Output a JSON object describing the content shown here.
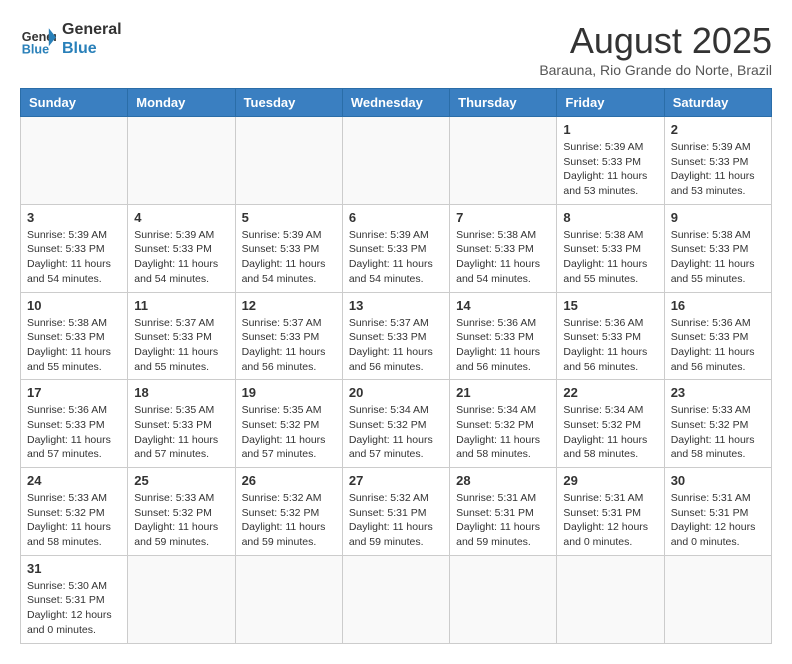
{
  "header": {
    "logo_general": "General",
    "logo_blue": "Blue",
    "month_title": "August 2025",
    "subtitle": "Barauna, Rio Grande do Norte, Brazil"
  },
  "days_of_week": [
    "Sunday",
    "Monday",
    "Tuesday",
    "Wednesday",
    "Thursday",
    "Friday",
    "Saturday"
  ],
  "weeks": [
    [
      {
        "day": "",
        "info": ""
      },
      {
        "day": "",
        "info": ""
      },
      {
        "day": "",
        "info": ""
      },
      {
        "day": "",
        "info": ""
      },
      {
        "day": "",
        "info": ""
      },
      {
        "day": "1",
        "info": "Sunrise: 5:39 AM\nSunset: 5:33 PM\nDaylight: 11 hours\nand 53 minutes."
      },
      {
        "day": "2",
        "info": "Sunrise: 5:39 AM\nSunset: 5:33 PM\nDaylight: 11 hours\nand 53 minutes."
      }
    ],
    [
      {
        "day": "3",
        "info": "Sunrise: 5:39 AM\nSunset: 5:33 PM\nDaylight: 11 hours\nand 54 minutes."
      },
      {
        "day": "4",
        "info": "Sunrise: 5:39 AM\nSunset: 5:33 PM\nDaylight: 11 hours\nand 54 minutes."
      },
      {
        "day": "5",
        "info": "Sunrise: 5:39 AM\nSunset: 5:33 PM\nDaylight: 11 hours\nand 54 minutes."
      },
      {
        "day": "6",
        "info": "Sunrise: 5:39 AM\nSunset: 5:33 PM\nDaylight: 11 hours\nand 54 minutes."
      },
      {
        "day": "7",
        "info": "Sunrise: 5:38 AM\nSunset: 5:33 PM\nDaylight: 11 hours\nand 54 minutes."
      },
      {
        "day": "8",
        "info": "Sunrise: 5:38 AM\nSunset: 5:33 PM\nDaylight: 11 hours\nand 55 minutes."
      },
      {
        "day": "9",
        "info": "Sunrise: 5:38 AM\nSunset: 5:33 PM\nDaylight: 11 hours\nand 55 minutes."
      }
    ],
    [
      {
        "day": "10",
        "info": "Sunrise: 5:38 AM\nSunset: 5:33 PM\nDaylight: 11 hours\nand 55 minutes."
      },
      {
        "day": "11",
        "info": "Sunrise: 5:37 AM\nSunset: 5:33 PM\nDaylight: 11 hours\nand 55 minutes."
      },
      {
        "day": "12",
        "info": "Sunrise: 5:37 AM\nSunset: 5:33 PM\nDaylight: 11 hours\nand 56 minutes."
      },
      {
        "day": "13",
        "info": "Sunrise: 5:37 AM\nSunset: 5:33 PM\nDaylight: 11 hours\nand 56 minutes."
      },
      {
        "day": "14",
        "info": "Sunrise: 5:36 AM\nSunset: 5:33 PM\nDaylight: 11 hours\nand 56 minutes."
      },
      {
        "day": "15",
        "info": "Sunrise: 5:36 AM\nSunset: 5:33 PM\nDaylight: 11 hours\nand 56 minutes."
      },
      {
        "day": "16",
        "info": "Sunrise: 5:36 AM\nSunset: 5:33 PM\nDaylight: 11 hours\nand 56 minutes."
      }
    ],
    [
      {
        "day": "17",
        "info": "Sunrise: 5:36 AM\nSunset: 5:33 PM\nDaylight: 11 hours\nand 57 minutes."
      },
      {
        "day": "18",
        "info": "Sunrise: 5:35 AM\nSunset: 5:33 PM\nDaylight: 11 hours\nand 57 minutes."
      },
      {
        "day": "19",
        "info": "Sunrise: 5:35 AM\nSunset: 5:32 PM\nDaylight: 11 hours\nand 57 minutes."
      },
      {
        "day": "20",
        "info": "Sunrise: 5:34 AM\nSunset: 5:32 PM\nDaylight: 11 hours\nand 57 minutes."
      },
      {
        "day": "21",
        "info": "Sunrise: 5:34 AM\nSunset: 5:32 PM\nDaylight: 11 hours\nand 58 minutes."
      },
      {
        "day": "22",
        "info": "Sunrise: 5:34 AM\nSunset: 5:32 PM\nDaylight: 11 hours\nand 58 minutes."
      },
      {
        "day": "23",
        "info": "Sunrise: 5:33 AM\nSunset: 5:32 PM\nDaylight: 11 hours\nand 58 minutes."
      }
    ],
    [
      {
        "day": "24",
        "info": "Sunrise: 5:33 AM\nSunset: 5:32 PM\nDaylight: 11 hours\nand 58 minutes."
      },
      {
        "day": "25",
        "info": "Sunrise: 5:33 AM\nSunset: 5:32 PM\nDaylight: 11 hours\nand 59 minutes."
      },
      {
        "day": "26",
        "info": "Sunrise: 5:32 AM\nSunset: 5:32 PM\nDaylight: 11 hours\nand 59 minutes."
      },
      {
        "day": "27",
        "info": "Sunrise: 5:32 AM\nSunset: 5:31 PM\nDaylight: 11 hours\nand 59 minutes."
      },
      {
        "day": "28",
        "info": "Sunrise: 5:31 AM\nSunset: 5:31 PM\nDaylight: 11 hours\nand 59 minutes."
      },
      {
        "day": "29",
        "info": "Sunrise: 5:31 AM\nSunset: 5:31 PM\nDaylight: 12 hours\nand 0 minutes."
      },
      {
        "day": "30",
        "info": "Sunrise: 5:31 AM\nSunset: 5:31 PM\nDaylight: 12 hours\nand 0 minutes."
      }
    ],
    [
      {
        "day": "31",
        "info": "Sunrise: 5:30 AM\nSunset: 5:31 PM\nDaylight: 12 hours\nand 0 minutes."
      },
      {
        "day": "",
        "info": ""
      },
      {
        "day": "",
        "info": ""
      },
      {
        "day": "",
        "info": ""
      },
      {
        "day": "",
        "info": ""
      },
      {
        "day": "",
        "info": ""
      },
      {
        "day": "",
        "info": ""
      }
    ]
  ]
}
